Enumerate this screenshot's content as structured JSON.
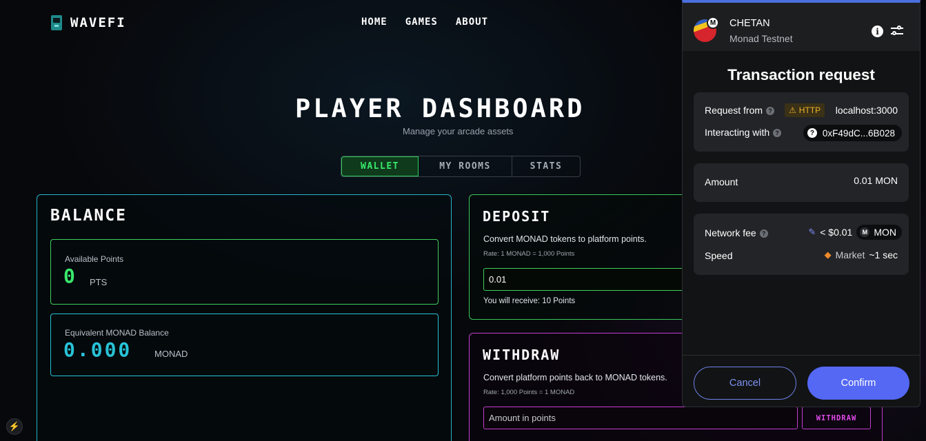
{
  "nav": {
    "logo": "WAVEFI",
    "links": [
      "HOME",
      "GAMES",
      "ABOUT"
    ]
  },
  "dashboard": {
    "title": "PLAYER DASHBOARD",
    "subtitle": "Manage your arcade assets",
    "tabs": [
      "WALLET",
      "MY ROOMS",
      "STATS"
    ],
    "active_tab": "WALLET"
  },
  "balance": {
    "title": "BALANCE",
    "points_label": "Available Points",
    "points_value": "0",
    "points_unit": "PTS",
    "monad_label": "Equivalent MONAD Balance",
    "monad_value": "0.000",
    "monad_unit": "MONAD"
  },
  "deposit": {
    "title": "DEPOSIT",
    "description": "Convert MONAD tokens to platform points.",
    "rate": "Rate: 1 MONAD = 1,000 Points",
    "input_value": "0.01",
    "receive_text": "You will receive: 10 Points"
  },
  "withdraw": {
    "title": "WITHDRAW",
    "description": "Convert platform points back to MONAD tokens.",
    "rate": "Rate: 1,000 Points = 1 MONAD",
    "input_placeholder": "Amount in points",
    "button": "WITHDRAW"
  },
  "wallet_popup": {
    "account_name": "CHETAN",
    "network": "Monad Testnet",
    "badge": "M",
    "title": "Transaction request",
    "request_from_label": "Request from",
    "protocol_badge": "HTTP",
    "request_from_value": "localhost:3000",
    "interacting_label": "Interacting with",
    "interacting_value": "0xF49dC...6B028",
    "amount_label": "Amount",
    "amount_value": "0.01 MON",
    "fee_label": "Network fee",
    "fee_value": "< $0.01",
    "fee_token": "MON",
    "speed_label": "Speed",
    "speed_value": "Market",
    "speed_time": "~1 sec",
    "cancel": "Cancel",
    "confirm": "Confirm",
    "colors": {
      "accent": "#5468f4",
      "header_bar": "#4b6fde"
    }
  },
  "colors": {
    "green": "#39e86b",
    "cyan": "#28c3d6",
    "magenta": "#c53dd1"
  },
  "icons": [
    "arcade-cabinet-icon",
    "info-icon",
    "settings-sliders-icon",
    "warning-icon",
    "question-icon",
    "pencil-icon",
    "fox-icon",
    "bolt-icon"
  ]
}
